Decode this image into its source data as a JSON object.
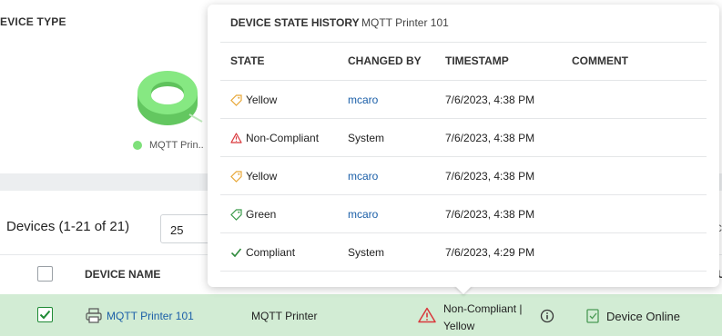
{
  "device_type_widget": {
    "title": "EVICE TYPE",
    "legend_label": "MQTT Prin..",
    "ring_color": "#7ee07a"
  },
  "devices": {
    "title": "Devices (1-21 of 21)",
    "page_size": "25",
    "columns": {
      "device_name": "DEVICE NAME"
    },
    "row": {
      "name": "MQTT Printer 101",
      "type": "MQTT Printer",
      "state_line1": "Non-Compliant |",
      "state_line2": "Yellow",
      "status": "Device Online",
      "checked": true
    }
  },
  "popover": {
    "title": "DEVICE STATE HISTORY",
    "subtitle": "MQTT Printer 101",
    "headers": {
      "state": "STATE",
      "changed_by": "CHANGED BY",
      "timestamp": "TIMESTAMP",
      "comment": "COMMENT"
    },
    "rows": [
      {
        "state": "Yellow",
        "icon": "tag-icon",
        "icon_color": "#e8a838",
        "changed_by": "mcaro",
        "by_is_link": true,
        "timestamp": "7/6/2023, 4:38 PM",
        "comment": ""
      },
      {
        "state": "Non-Compliant",
        "icon": "warning-icon",
        "icon_color": "#d9373b",
        "changed_by": "System",
        "by_is_link": false,
        "timestamp": "7/6/2023, 4:38 PM",
        "comment": ""
      },
      {
        "state": "Yellow",
        "icon": "tag-icon",
        "icon_color": "#e8a838",
        "changed_by": "mcaro",
        "by_is_link": true,
        "timestamp": "7/6/2023, 4:38 PM",
        "comment": ""
      },
      {
        "state": "Green",
        "icon": "tag-icon",
        "icon_color": "#3a9a4a",
        "changed_by": "mcaro",
        "by_is_link": true,
        "timestamp": "7/6/2023, 4:38 PM",
        "comment": ""
      },
      {
        "state": "Compliant",
        "icon": "check-icon",
        "icon_color": "#2f8a3c",
        "changed_by": "System",
        "by_is_link": false,
        "timestamp": "7/6/2023, 4:29 PM",
        "comment": ""
      }
    ]
  },
  "colors": {
    "accent_link": "#1b5fa8",
    "selected_row": "#d2ecd4",
    "warning": "#d9373b"
  }
}
